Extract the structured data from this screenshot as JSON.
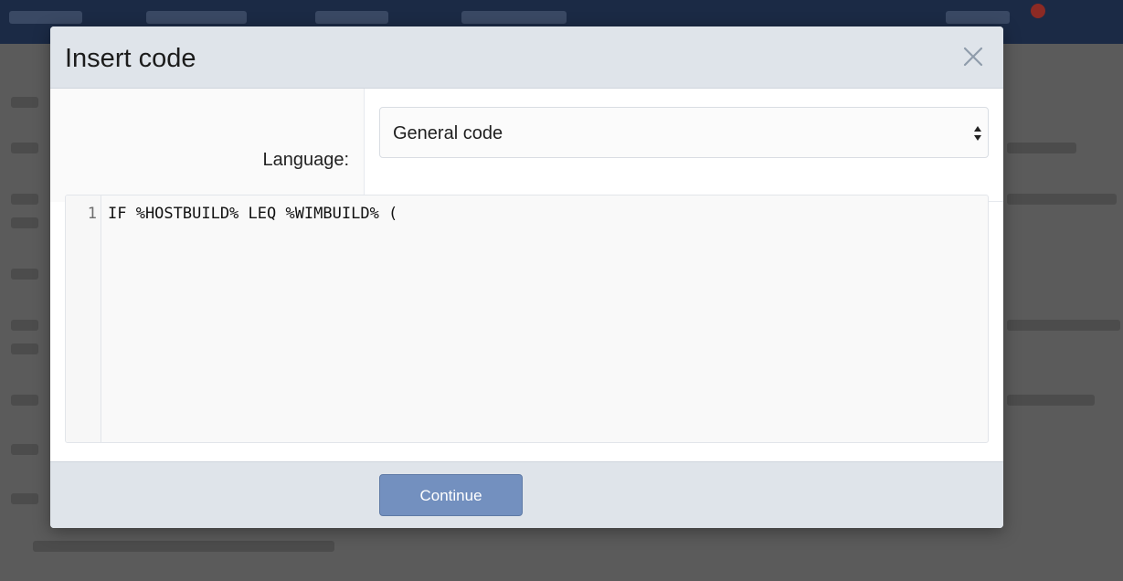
{
  "dialog": {
    "title": "Insert code",
    "close_icon": "close-icon"
  },
  "language": {
    "label": "Language:",
    "selected": "General code",
    "arrow_icon": "select-arrows-icon"
  },
  "editor": {
    "line_numbers": [
      "1"
    ],
    "lines": [
      "IF %HOSTBUILD% LEQ %WIMBUILD% ("
    ]
  },
  "footer": {
    "continue_label": "Continue"
  },
  "colors": {
    "header_bg": "#dfe4ea",
    "button_bg": "#7390bf",
    "topbar_bg": "#1b2a45"
  }
}
